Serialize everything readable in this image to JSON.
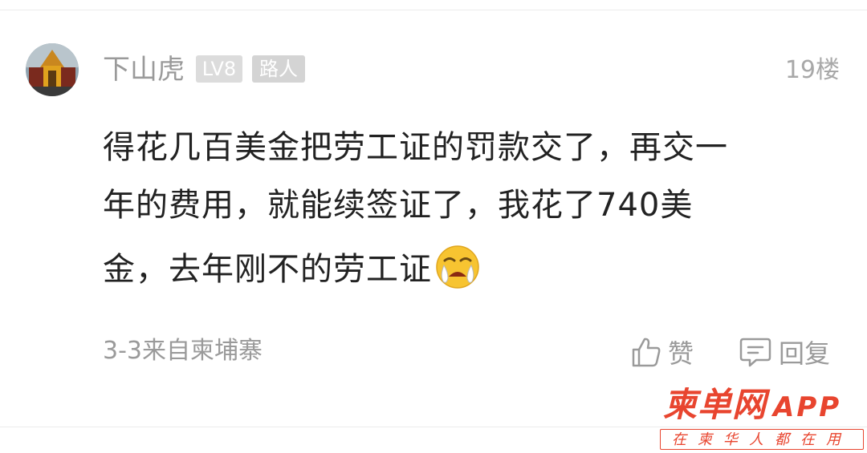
{
  "comment": {
    "username": "下山虎",
    "level_badge": "LV8",
    "role_badge": "路人",
    "floor": "19楼",
    "content_lines": [
      "得花几百美金把劳工证的罚款交了，再交一",
      "年的费用，就能续签证了，我花了740美",
      "金，去年刚不的劳工证"
    ],
    "emoji": "crying-emoji",
    "meta": "3-3来自柬埔寨",
    "actions": {
      "like_label": "赞",
      "reply_label": "回复"
    }
  },
  "watermark": {
    "title": "柬单网",
    "app": "APP",
    "slogan": "在柬华人都在用"
  },
  "colors": {
    "text_primary": "#222222",
    "text_secondary": "#9a9a9a",
    "badge_bg": "#dcdcdc",
    "brand_red": "#e8452f"
  }
}
